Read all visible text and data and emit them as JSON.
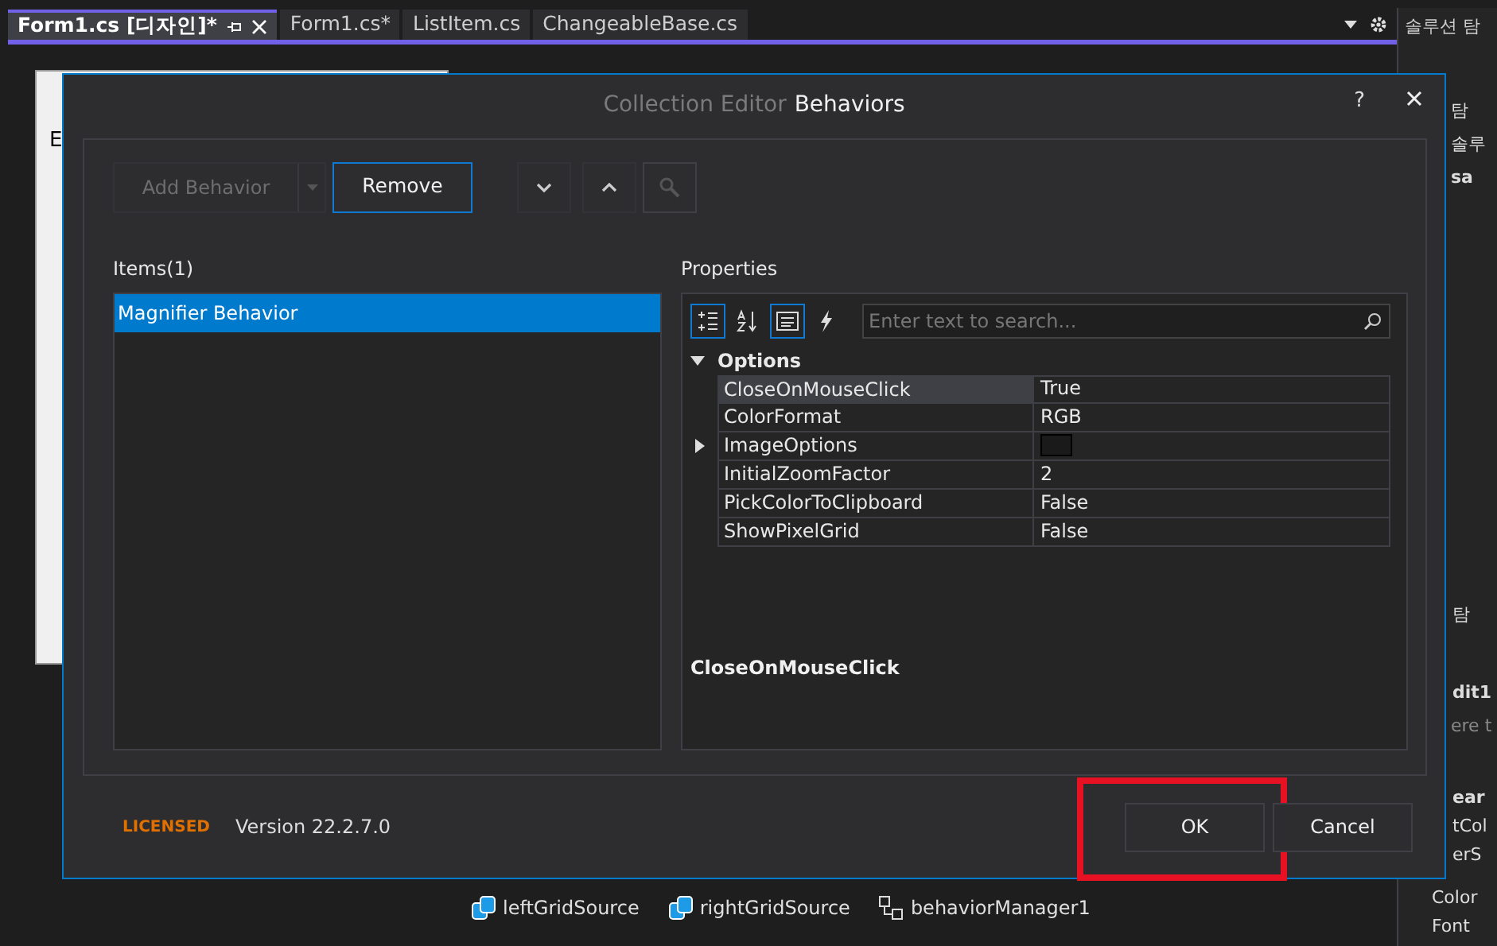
{
  "document_tabs": [
    {
      "label": "Form1.cs [디자인]*",
      "selected": true
    },
    {
      "label": "Form1.cs*",
      "selected": false
    },
    {
      "label": "ListItem.cs",
      "selected": false
    },
    {
      "label": "ChangeableBase.cs",
      "selected": false
    }
  ],
  "designer": {
    "menu_text": "E"
  },
  "side_panel": {
    "tab": "솔루션 탐",
    "lines": [
      "탐",
      "솔루",
      "sa"
    ],
    "lower_tab": "탐",
    "object": "dit1",
    "search_placeholder": "ere t",
    "props": [
      "ear",
      "tCol",
      "erS",
      "Color",
      "Font"
    ]
  },
  "component_tray": [
    {
      "label": "leftGridSource",
      "kind": "data"
    },
    {
      "label": "rightGridSource",
      "kind": "data"
    },
    {
      "label": "behaviorManager1",
      "kind": "manager"
    }
  ],
  "dialog": {
    "title_prefix": "Collection Editor",
    "title": "Behaviors",
    "help": "?",
    "add_button": {
      "label": "Add Behavior",
      "disabled": true
    },
    "remove_button": {
      "label": "Remove",
      "focused": true
    },
    "items_label": "Items(1)",
    "items": [
      {
        "label": "Magnifier Behavior",
        "selected": true
      }
    ],
    "properties_label": "Properties",
    "view_buttons": [
      {
        "kind": "categorized",
        "selected": true
      },
      {
        "kind": "alphabetical",
        "selected": false
      },
      {
        "kind": "pages",
        "selected": true
      },
      {
        "kind": "events",
        "selected": false
      }
    ],
    "search_placeholder": "Enter text to search...",
    "category": {
      "label": "Options",
      "expanded": true
    },
    "properties": [
      {
        "name": "CloseOnMouseClick",
        "value": "True",
        "kind": "text",
        "selected": true,
        "expandable": false
      },
      {
        "name": "ColorFormat",
        "value": "RGB",
        "kind": "text",
        "selected": false,
        "expandable": false
      },
      {
        "name": "ImageOptions",
        "kind": "swatch",
        "color": "#1a1a1a",
        "selected": false,
        "expandable": true
      },
      {
        "name": "InitialZoomFactor",
        "value": "2",
        "kind": "text",
        "selected": false,
        "expandable": false
      },
      {
        "name": "PickColorToClipboard",
        "value": "False",
        "kind": "text",
        "selected": false,
        "expandable": false
      },
      {
        "name": "ShowPixelGrid",
        "value": "False",
        "kind": "text",
        "selected": false,
        "expandable": false
      }
    ],
    "description": "CloseOnMouseClick",
    "license": "LICENSED",
    "version": "Version 22.2.7.0",
    "buttons": [
      {
        "label": "OK",
        "highlighted": true
      },
      {
        "label": "Cancel",
        "highlighted": false
      }
    ]
  }
}
